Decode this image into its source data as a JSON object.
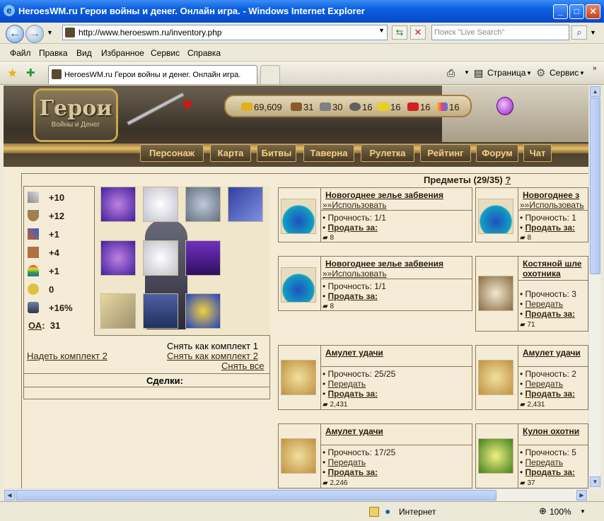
{
  "window": {
    "title": "HeroesWM.ru Герои войны и денег. Онлайн игра. - Windows Internet Explorer"
  },
  "address": {
    "url": "http://www.heroeswm.ru/inventory.php",
    "search_placeholder": "Поиск \"Live Search\""
  },
  "menu": [
    "Файл",
    "Правка",
    "Вид",
    "Избранное",
    "Сервис",
    "Справка"
  ],
  "tab": {
    "label": "HeroesWM.ru Герои войны и денег. Онлайн игра."
  },
  "toolbar": {
    "page": "Страница",
    "service": "Сервис"
  },
  "status": {
    "zone": "Интернет",
    "zoom": "100%"
  },
  "game": {
    "logo": "Герои",
    "logo_sub": "Войны и Денег",
    "resources": [
      "69,609",
      "31",
      "30",
      "16",
      "16",
      "16",
      "16"
    ],
    "nav": [
      "Персонаж",
      "Карта",
      "Битвы",
      "Таверна",
      "Рулетка",
      "Рейтинг",
      "Форум",
      "Чат"
    ]
  },
  "stats": [
    {
      "icon": "attack-icon",
      "value": "+10"
    },
    {
      "icon": "defense-icon",
      "value": "+12"
    },
    {
      "icon": "spellpower-icon",
      "value": "+1"
    },
    {
      "icon": "knowledge-icon",
      "value": "+4"
    },
    {
      "icon": "luck-icon",
      "value": "+1"
    },
    {
      "icon": "morale-icon",
      "value": "0"
    },
    {
      "icon": "initiative-icon",
      "value": "+16%"
    }
  ],
  "oa": {
    "label": "ОА",
    "value": "31"
  },
  "sets": {
    "wear2": "Надеть комплект 2",
    "remove1": "Снять как комплект 1",
    "remove2": "Снять как комплект 2",
    "remove_all": "Снять все"
  },
  "deals": "Сделки:",
  "items_header": {
    "text": "Предметы (29/35)",
    "help": "?"
  },
  "cards": [
    {
      "name": "Новогоднее зелье забвения",
      "use": "»»Использовать",
      "durability": "Прочность: 1/1",
      "transfer": "",
      "sell": "Продать за:",
      "price": "8"
    },
    {
      "name": "Новогоднее з",
      "use": "»»Использовать",
      "durability": "Прочность: 1",
      "transfer": "",
      "sell": "Продать за:",
      "price": "8"
    },
    {
      "name": "Новогоднее зелье забвения",
      "use": "»»Использовать",
      "durability": "Прочность: 1/1",
      "transfer": "",
      "sell": "Продать за:",
      "price": "8"
    },
    {
      "name": "Костяной шле",
      "name2": "охотника",
      "durability": "Прочность: 3",
      "transfer": "Передать",
      "sell": "Продать за:",
      "price": "71"
    },
    {
      "name": "Амулет удачи",
      "durability": "Прочность: 25/25",
      "transfer": "Передать",
      "sell": "Продать за:",
      "price": "2,431"
    },
    {
      "name": "Амулет удачи",
      "durability": "Прочность: 2",
      "transfer": "Передать",
      "sell": "Продать за:",
      "price": "2,431"
    },
    {
      "name": "Амулет удачи",
      "durability": "Прочность: 17/25",
      "transfer": "Передать",
      "sell": "Продать за:",
      "price": "2,246"
    },
    {
      "name": "Кулон охотни",
      "durability": "Прочность: 5",
      "transfer": "Передать",
      "sell": "Продать за:",
      "price": "37"
    }
  ]
}
